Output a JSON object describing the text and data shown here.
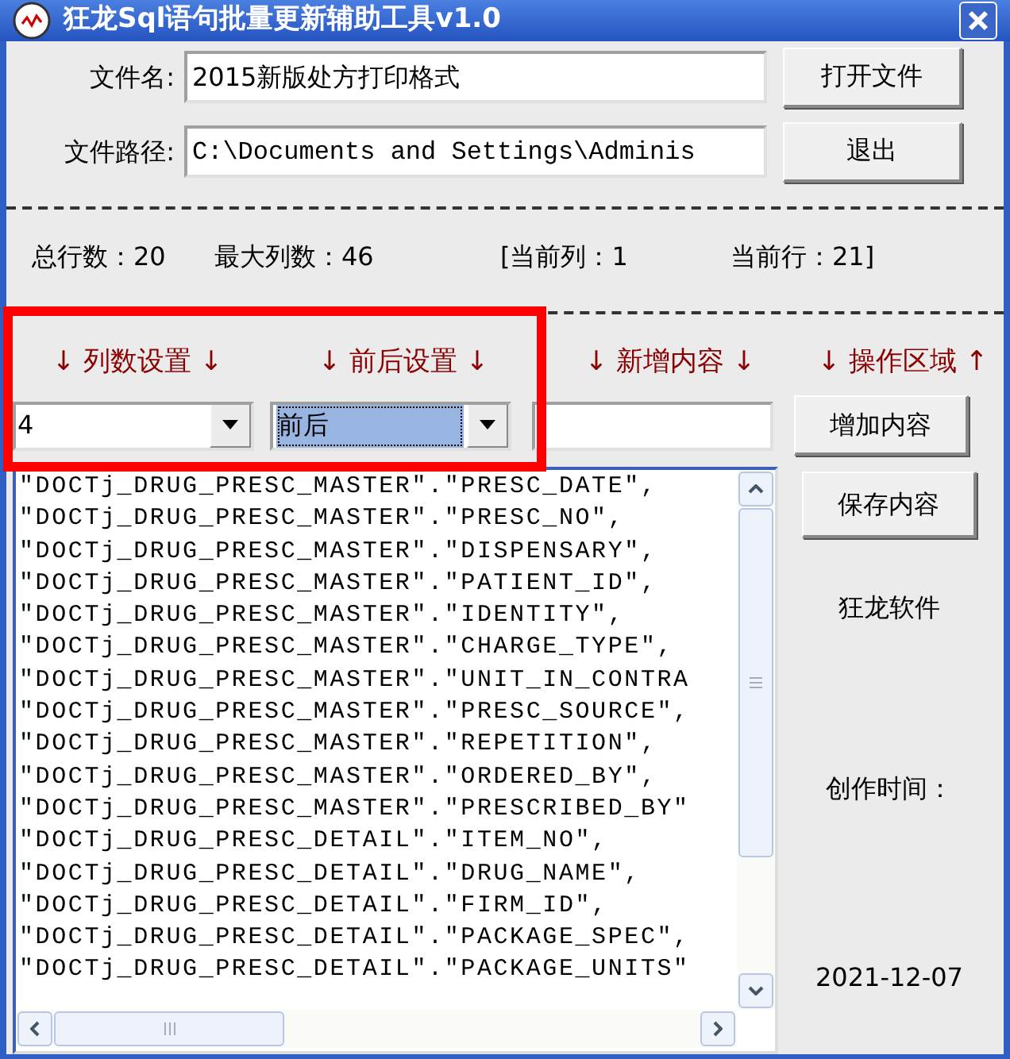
{
  "window": {
    "title": "狂龙Sql语句批量更新辅助工具v1.0"
  },
  "file_name": {
    "label": "文件名:",
    "value": "2015新版处方打印格式"
  },
  "file_path": {
    "label": "文件路径:",
    "value": "C:\\Documents and Settings\\Adminis"
  },
  "buttons": [
    "打开文件",
    "退出"
  ],
  "stats": [
    "总行数：20",
    "最大列数：46",
    "[当前列：1",
    "当前行：21]"
  ],
  "section_headers": [
    "↓ 列数设置 ↓",
    "↓ 前后设置 ↓",
    "↓ 新增内容 ↓",
    "↓ 操作区域 ↑"
  ],
  "column_count": {
    "value": "4",
    "selected": false
  },
  "position": {
    "value": "前后",
    "selected": true
  },
  "add_button": "增加内容",
  "content_lines": [
    "\"DOCTj_DRUG_PRESC_MASTER\".\"PRESC_DATE\",",
    "\"DOCTj_DRUG_PRESC_MASTER\".\"PRESC_NO\",",
    "\"DOCTj_DRUG_PRESC_MASTER\".\"DISPENSARY\",",
    "\"DOCTj_DRUG_PRESC_MASTER\".\"PATIENT_ID\",",
    "\"DOCTj_DRUG_PRESC_MASTER\".\"IDENTITY\",",
    "\"DOCTj_DRUG_PRESC_MASTER\".\"CHARGE_TYPE\",",
    "\"DOCTj_DRUG_PRESC_MASTER\".\"UNIT_IN_CONTRA",
    "\"DOCTj_DRUG_PRESC_MASTER\".\"PRESC_SOURCE\",",
    "\"DOCTj_DRUG_PRESC_MASTER\".\"REPETITION\",",
    "\"DOCTj_DRUG_PRESC_MASTER\".\"ORDERED_BY\",",
    "\"DOCTj_DRUG_PRESC_MASTER\".\"PRESCRIBED_BY\"",
    "\"DOCTj_DRUG_PRESC_DETAIL\".\"ITEM_NO\",",
    "\"DOCTj_DRUG_PRESC_DETAIL\".\"DRUG_NAME\",",
    "\"DOCTj_DRUG_PRESC_DETAIL\".\"FIRM_ID\",",
    "\"DOCTj_DRUG_PRESC_DETAIL\".\"PACKAGE_SPEC\",",
    "\"DOCTj_DRUG_PRESC_DETAIL\".\"PACKAGE_UNITS\""
  ],
  "save_button": "保存内容",
  "side_texts": [
    "狂龙软件",
    "创作时间：",
    "2021-12-07"
  ],
  "highlight": {
    "kind": "frame"
  }
}
